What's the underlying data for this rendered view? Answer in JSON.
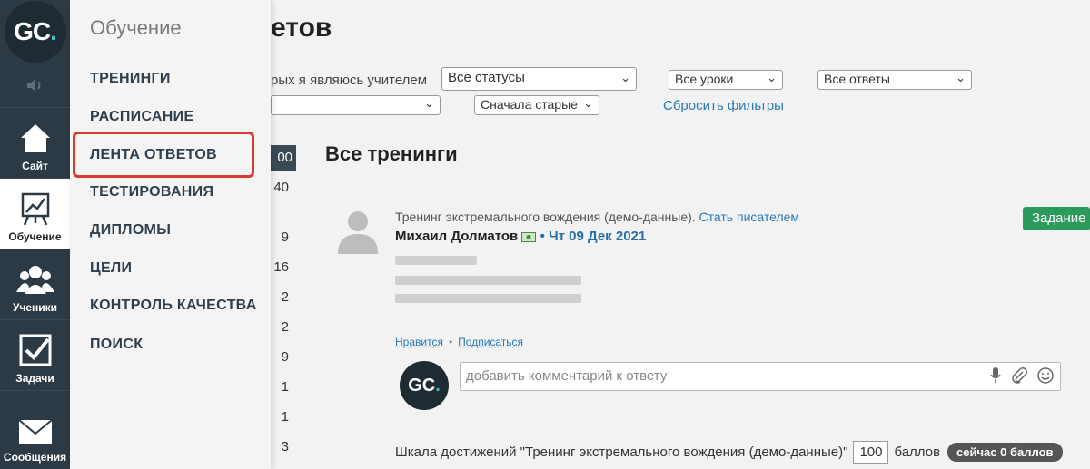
{
  "rail": {
    "logo": "GC",
    "logo_dot": ".",
    "items": [
      {
        "label": "Сайт",
        "icon": "home-icon"
      },
      {
        "label": "Обучение",
        "icon": "chart-board-icon"
      },
      {
        "label": "Ученики",
        "icon": "users-icon"
      },
      {
        "label": "Задачи",
        "icon": "checkbox-icon"
      },
      {
        "label": "Сообщения",
        "icon": "envelope-icon"
      }
    ]
  },
  "flyout": {
    "title": "Обучение",
    "items": [
      "ТРЕНИНГИ",
      "РАСПИСАНИЕ",
      "ЛЕНТА ОТВЕТОВ",
      "ТЕСТИРОВАНИЯ",
      "ДИПЛОМЫ",
      "ЦЕЛИ",
      "КОНТРОЛЬ КАЧЕСТВА",
      "ПОИСК"
    ],
    "highlighted": "ЛЕНТА ОТВЕТОВ"
  },
  "page": {
    "title_fragment": "етов",
    "filter_text": "рых я являюсь учителем",
    "status_select": "Все статусы",
    "lessons_select": "Все уроки",
    "answers_select": "Все ответы",
    "sort_select": "Сначала старые",
    "reset_link": "Сбросить фильтры",
    "counts": [
      "00",
      "40",
      "9",
      "16",
      "2",
      "2",
      "9",
      "1",
      "1",
      "3"
    ],
    "section_title": "Все тренинги",
    "post": {
      "training": "Тренинг экстремального вождения (демо-данные).",
      "become_writer": "Стать писателем",
      "author": "Михаил Долматов",
      "date": "Чт 09 Дек 2021",
      "badge": "Задание",
      "like": "Нравится",
      "subscribe": "Подписаться",
      "comment_placeholder": "добавить комментарий к ответу",
      "comment_avatar": "GC"
    },
    "scale": {
      "text": "Шкала достижений \"Тренинг экстремального вождения (демо-данные)\"",
      "value": "100",
      "unit": "баллов",
      "now": "сейчас 0 баллов"
    }
  },
  "colors": {
    "rail_bg": "#2b3a45",
    "highlight": "#d83a2d",
    "link": "#2a7ab8",
    "task_badge": "#2a9b5a"
  }
}
